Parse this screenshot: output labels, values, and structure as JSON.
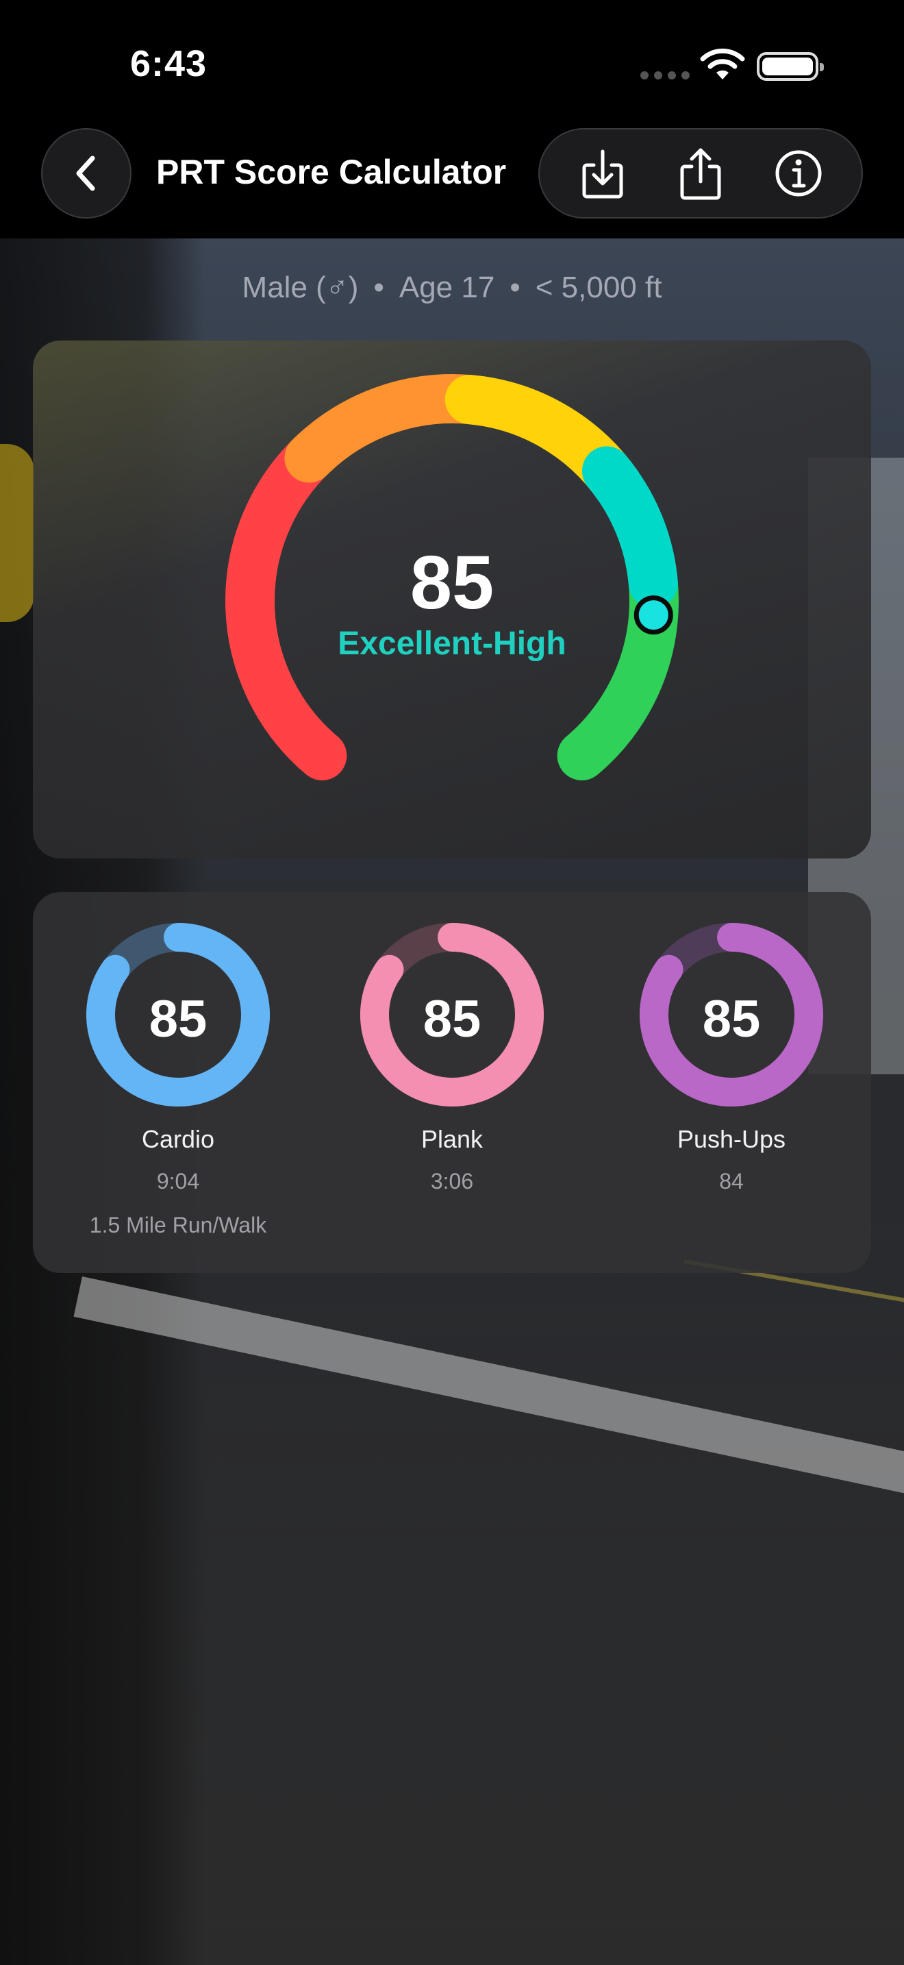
{
  "status_bar": {
    "time": "6:43"
  },
  "nav": {
    "title": "PRT Score Calculator",
    "back_icon": "chevron-left-icon",
    "actions": [
      "download-icon",
      "share-icon",
      "info-icon"
    ]
  },
  "profile": {
    "gender": "Male (♂)",
    "age": "Age 17",
    "altitude": "< 5,000 ft",
    "separator": "•"
  },
  "overall": {
    "score": "85",
    "rating": "Excellent-High",
    "score_value": 85,
    "rating_color": "#1fd1c0",
    "segments": [
      {
        "name": "red",
        "color": "#ff4246"
      },
      {
        "name": "orange",
        "color": "#ff9330"
      },
      {
        "name": "yellow",
        "color": "#ffd20a"
      },
      {
        "name": "teal",
        "color": "#00d8c8"
      },
      {
        "name": "green",
        "color": "#30d158"
      }
    ]
  },
  "components": [
    {
      "score": "85",
      "name": "Cardio",
      "result": "9:04",
      "detail": "1.5 Mile Run/Walk",
      "color": "#64b5f6",
      "track": "#3f5870",
      "fraction": 0.85
    },
    {
      "score": "85",
      "name": "Plank",
      "result": "3:06",
      "detail": "",
      "color": "#f48fb1",
      "track": "#5a4048",
      "fraction": 0.85
    },
    {
      "score": "85",
      "name": "Push-Ups",
      "result": "84",
      "detail": "",
      "color": "#ba68c8",
      "track": "#4e3c58",
      "fraction": 0.85
    }
  ]
}
